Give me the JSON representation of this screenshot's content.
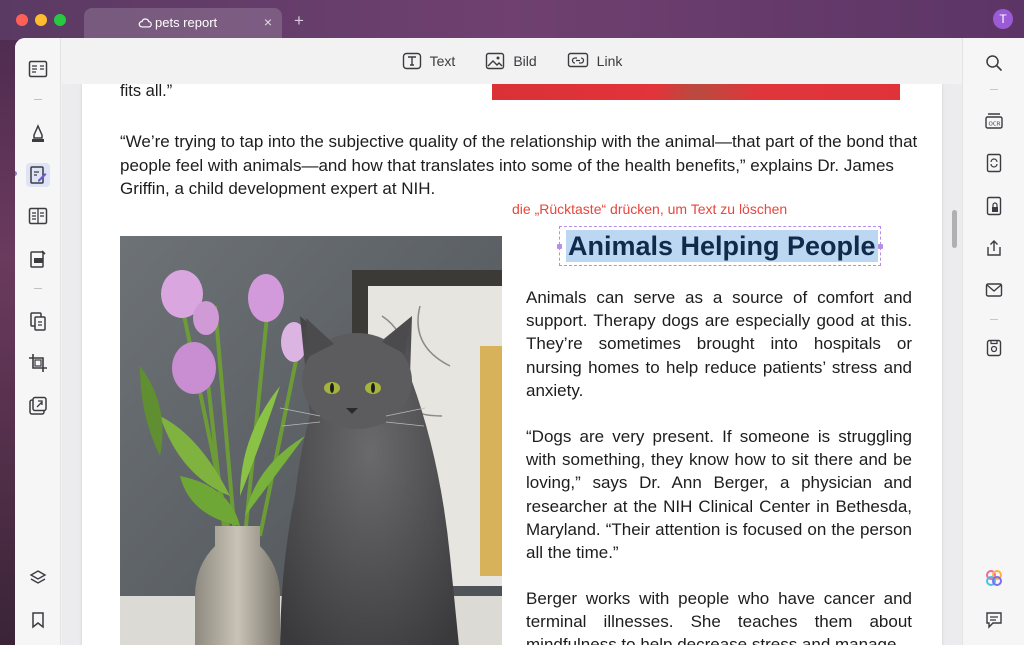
{
  "tab": {
    "title": "pets report",
    "close": "×",
    "new_tab": "+"
  },
  "user": {
    "initial": "T"
  },
  "edit_toolbar": {
    "text_label": "Text",
    "image_label": "Bild",
    "link_label": "Link"
  },
  "document": {
    "top_fragment": "fits all.”",
    "quote": "“We’re trying to tap into the subjective quality of the relationship with the animal—that part of the bond that people feel with animals—and how that translates into some of the health benefits,” explains Dr. James Griffin, a child development expert at NIH.",
    "hint": "die „Rücktaste“ drücken, um Text zu löschen",
    "headline": "Animals Helping People",
    "para1": "Animals can serve as a source of comfort and support. Therapy dogs are especially good at this. They’re sometimes brought into hospitals or nursing homes to help reduce patients’ stress and anxiety.",
    "para2": "“Dogs are very present. If someone is struggling with something, they know how to sit there and be loving,” says Dr. Ann Berger, a physician and researcher at the NIH Clinical Center in Bethesda, Maryland. “Their attention is focused on the person all the time.”",
    "para3": "Berger works with people who have cancer and terminal illnesses. She teaches them about mindfulness to help decrease stress and manage"
  },
  "colors": {
    "accent": "#8a7ae0",
    "hint_red": "#e8453c",
    "selection": "#bcd7f2",
    "headline_text": "#0f2a4a"
  },
  "icons": {
    "left_toolbar": [
      "reader-icon",
      "highlighter-icon",
      "edit-pdf-icon",
      "form-icon",
      "fill-sign-icon",
      "organize-pages-icon",
      "crop-icon",
      "stamp-icon",
      "layers-icon",
      "bookmark-icon"
    ],
    "right_toolbar": [
      "search-icon",
      "ocr-icon",
      "convert-icon",
      "protect-icon",
      "share-icon",
      "mail-icon",
      "save-icon",
      "ai-icon",
      "comment-icon"
    ]
  }
}
